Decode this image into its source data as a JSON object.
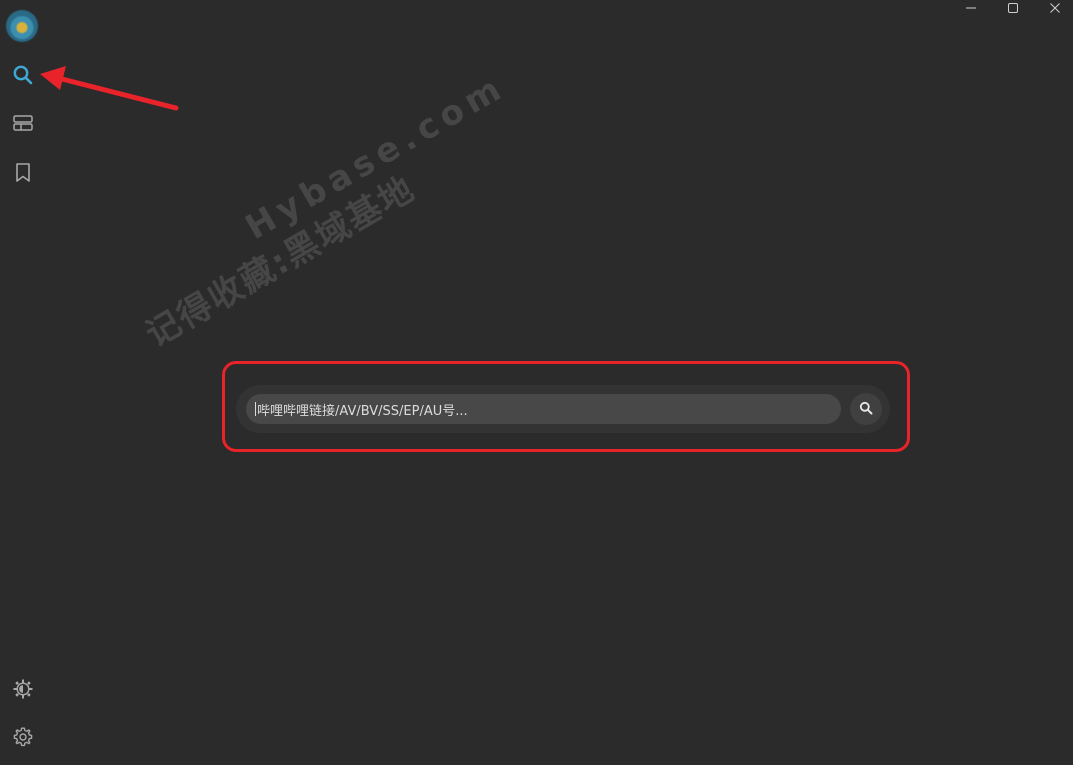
{
  "window": {
    "controls": [
      "minimize",
      "maximize",
      "close"
    ]
  },
  "sidebar": {
    "items": [
      {
        "id": "search",
        "icon": "search-icon",
        "active": true,
        "color": "#3fa9d6"
      },
      {
        "id": "list",
        "icon": "list-icon",
        "active": false
      },
      {
        "id": "bookmark",
        "icon": "bookmark-icon",
        "active": false
      }
    ],
    "bottom_items": [
      {
        "id": "theme",
        "icon": "theme-icon"
      },
      {
        "id": "settings",
        "icon": "gear-icon"
      }
    ]
  },
  "search": {
    "placeholder": "哔哩哔哩链接/AV/BV/SS/EP/AU号...",
    "button_icon": "search-icon"
  },
  "watermark": {
    "line1": "记得收藏:黑域基地",
    "line2": "Hybase.com"
  },
  "colors": {
    "background": "#2b2b2b",
    "accent": "#3fa9d6",
    "annotation": "#e8232a"
  }
}
